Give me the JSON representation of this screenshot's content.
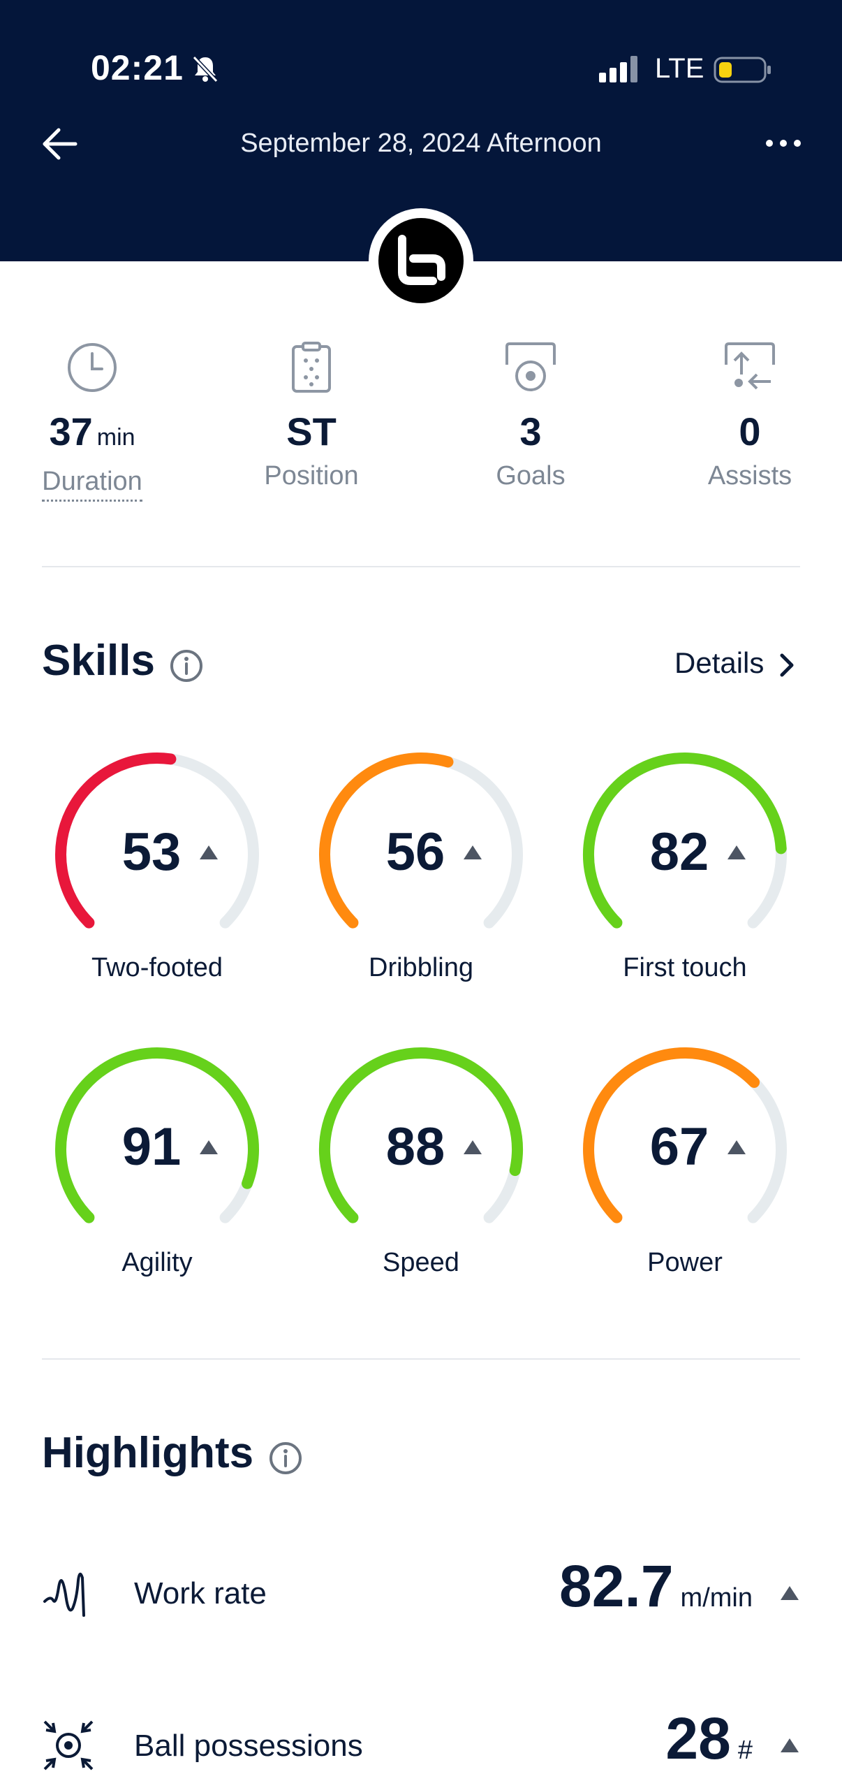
{
  "status_bar": {
    "time": "02:21",
    "network": "LTE"
  },
  "header": {
    "title": "September 28, 2024 Afternoon"
  },
  "stats": [
    {
      "value": "37",
      "unit": "min",
      "label": "Duration",
      "icon": "clock-icon"
    },
    {
      "value": "ST",
      "unit": "",
      "label": "Position",
      "icon": "clipboard-icon"
    },
    {
      "value": "3",
      "unit": "",
      "label": "Goals",
      "icon": "goal-icon"
    },
    {
      "value": "0",
      "unit": "",
      "label": "Assists",
      "icon": "assist-icon"
    }
  ],
  "skills": {
    "title": "Skills",
    "details_label": "Details",
    "items": [
      {
        "label": "Two-footed",
        "value": "53",
        "fraction": 0.53,
        "color": "#e8173b"
      },
      {
        "label": "Dribbling",
        "value": "56",
        "fraction": 0.56,
        "color": "#ff8a0f"
      },
      {
        "label": "First touch",
        "value": "82",
        "fraction": 0.82,
        "color": "#66d11b"
      },
      {
        "label": "Agility",
        "value": "91",
        "fraction": 0.91,
        "color": "#66d11b"
      },
      {
        "label": "Speed",
        "value": "88",
        "fraction": 0.88,
        "color": "#66d11b"
      },
      {
        "label": "Power",
        "value": "67",
        "fraction": 0.67,
        "color": "#ff8a0f"
      }
    ]
  },
  "highlights": {
    "title": "Highlights",
    "items": [
      {
        "label": "Work rate",
        "value": "82.7",
        "unit": "m/min",
        "icon": "work-rate-icon"
      },
      {
        "label": "Ball possessions",
        "value": "28",
        "unit": "#",
        "icon": "ball-possession-icon"
      }
    ]
  },
  "colors": {
    "header_bg": "#04163a",
    "track": "#e6ebee",
    "text": "#0b1a36",
    "muted": "#7d8794"
  }
}
